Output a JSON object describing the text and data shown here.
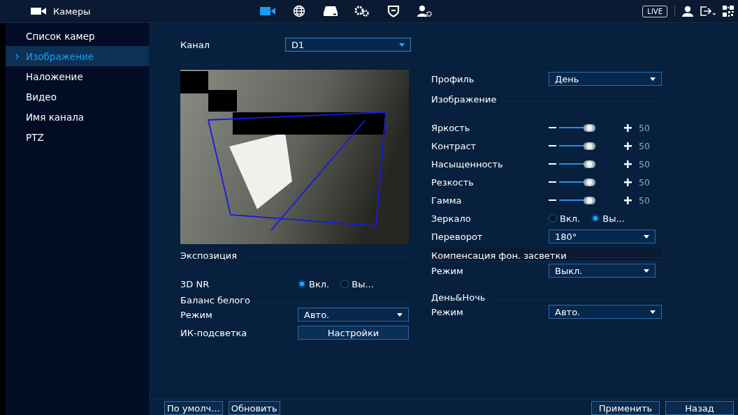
{
  "header": {
    "title": "Камеры",
    "nav": [
      {
        "kind": "camera",
        "selected": true
      },
      {
        "kind": "globe",
        "selected": false
      },
      {
        "kind": "disk",
        "selected": false
      },
      {
        "kind": "gears",
        "selected": false
      },
      {
        "kind": "shield",
        "selected": false
      },
      {
        "kind": "user-gear",
        "selected": false
      }
    ],
    "live": "LIVE"
  },
  "sidebar": {
    "items": [
      {
        "label": "Список камер",
        "selected": false
      },
      {
        "label": "Изображение",
        "selected": true
      },
      {
        "label": "Наложение",
        "selected": false
      },
      {
        "label": "Видео",
        "selected": false
      },
      {
        "label": "Имя канала",
        "selected": false
      },
      {
        "label": "PTZ",
        "selected": false
      }
    ]
  },
  "channel": {
    "label": "Канал",
    "value": "D1"
  },
  "profile": {
    "label": "Профиль",
    "value": "День"
  },
  "image_section": "Изображение",
  "sliders": [
    {
      "label": "Яркость",
      "level": 0.5,
      "reading": "50"
    },
    {
      "label": "Контраст",
      "level": 0.5,
      "reading": "50"
    },
    {
      "label": "Насыщенность",
      "level": 0.5,
      "reading": "50"
    },
    {
      "label": "Резкость",
      "level": 0.5,
      "reading": "50"
    },
    {
      "label": "Гамма",
      "level": 0.5,
      "reading": "50"
    }
  ],
  "mirror": {
    "label": "Зеркало",
    "options": [
      {
        "label": "Вкл.",
        "selected": false
      },
      {
        "label": "Вы...",
        "selected": true
      }
    ]
  },
  "flip": {
    "label": "Переворот",
    "value": "180°"
  },
  "backlight": {
    "title": "Компенсация фон. засветки",
    "mode_label": "Режим",
    "value": "Выкл."
  },
  "exposure": {
    "title": "Экспозиция"
  },
  "nr": {
    "label": "3D NR",
    "options": [
      {
        "label": "Вкл.",
        "selected": true
      },
      {
        "label": "Вы...",
        "selected": false
      }
    ]
  },
  "white_balance": {
    "title": "Баланс белого",
    "mode_label": "Режим",
    "value": "Авто."
  },
  "ir": {
    "label": "ИК-подсветка",
    "button": "Настройки"
  },
  "day_night": {
    "title": "День&Ночь",
    "mode_label": "Режим",
    "value": "Авто."
  },
  "footer": {
    "left": [
      "По умолч...",
      "Обновить"
    ],
    "right": [
      "Применить",
      "Назад"
    ]
  }
}
